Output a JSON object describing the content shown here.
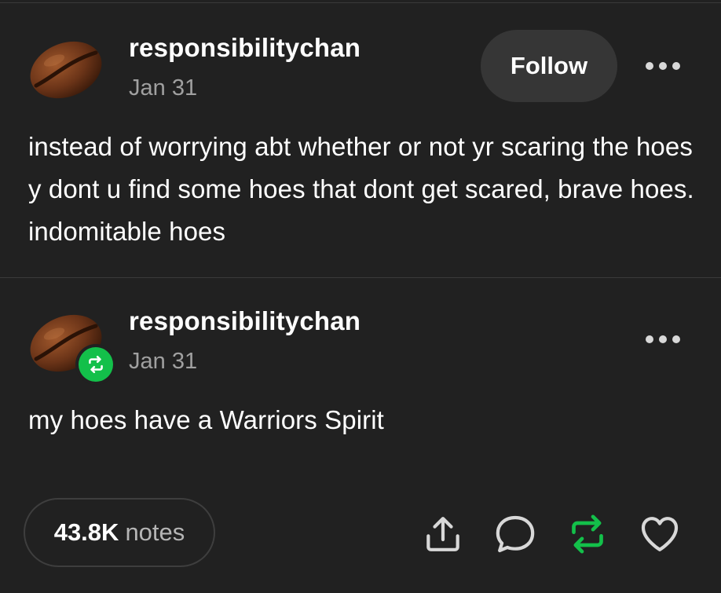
{
  "post": {
    "username": "responsibilitychan",
    "date": "Jan 31",
    "follow_label": "Follow",
    "text": "instead of worrying abt whether or not yr scaring the hoes y dont u find some hoes that dont get scared, brave hoes. indomitable hoes",
    "avatar_icon": "coffee-bean-icon"
  },
  "reblog": {
    "username": "responsibilitychan",
    "date": "Jan 31",
    "text": "my hoes have a Warriors Spirit",
    "badge_icon": "reblog-badge-icon",
    "badge_color": "#13c04a"
  },
  "footer": {
    "notes_count": "43.8K",
    "notes_label": "notes",
    "actions": [
      "share-icon",
      "reply-icon",
      "reblog-icon",
      "like-icon"
    ],
    "reblog_color": "#13c04a"
  },
  "theme": {
    "background": "#212121",
    "text": "#ffffff",
    "muted": "#a0a0a0",
    "button_bg": "#363636"
  }
}
